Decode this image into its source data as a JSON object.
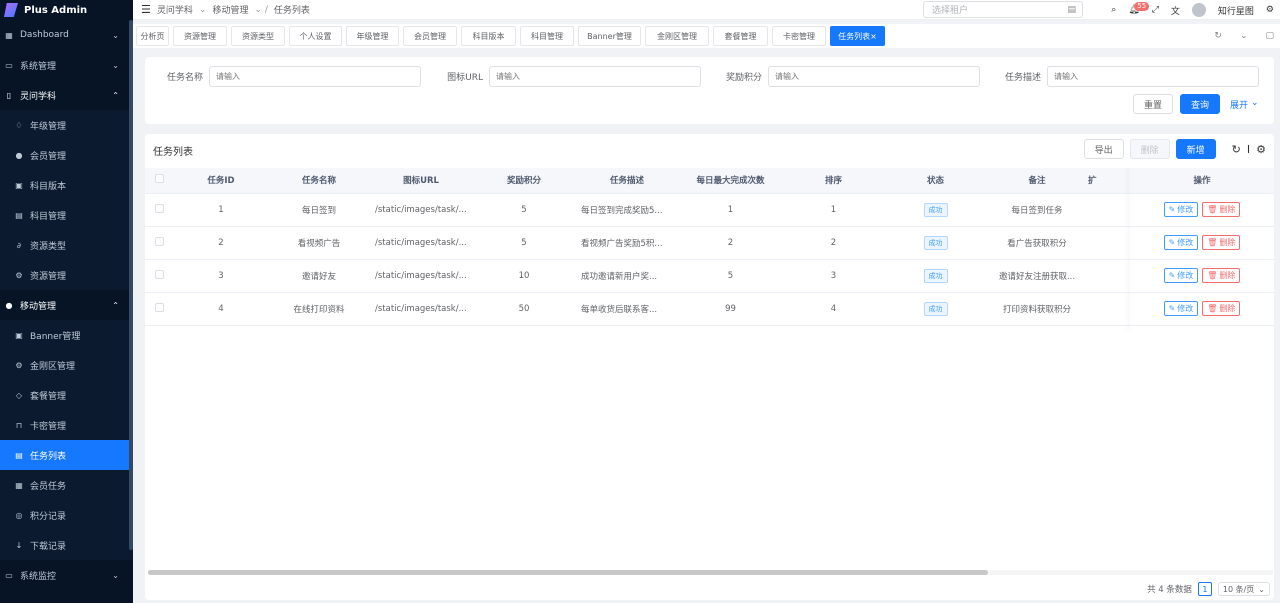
{
  "app": {
    "title": "Plus Admin"
  },
  "sidebar": {
    "items": [
      {
        "label": "Dashboard",
        "icon": "grid-icon",
        "chev": "⌄"
      },
      {
        "label": "系统管理",
        "icon": "monitor-icon",
        "chev": "⌄"
      },
      {
        "label": "灵问学科",
        "icon": "book-icon",
        "chev": "⌃"
      },
      {
        "label": "年级管理",
        "icon": "bell-icon",
        "sub": true
      },
      {
        "label": "会员管理",
        "icon": "chat-icon",
        "sub": true
      },
      {
        "label": "科目版本",
        "icon": "image-icon",
        "sub": true
      },
      {
        "label": "科目管理",
        "icon": "reader-icon",
        "sub": true
      },
      {
        "label": "资源类型",
        "icon": "link-icon",
        "sub": true
      },
      {
        "label": "资源管理",
        "icon": "settings-icon",
        "sub": true
      },
      {
        "label": "移动管理",
        "icon": "chat-icon",
        "chev": "⌃"
      },
      {
        "label": "Banner管理",
        "icon": "image-icon",
        "sub": true
      },
      {
        "label": "金刚区管理",
        "icon": "settings-icon",
        "sub": true
      },
      {
        "label": "套餐管理",
        "icon": "package-icon",
        "sub": true
      },
      {
        "label": "卡密管理",
        "icon": "lock-icon",
        "sub": true
      },
      {
        "label": "任务列表",
        "icon": "list-icon",
        "sub": true,
        "active": true
      },
      {
        "label": "会员任务",
        "icon": "grid-icon",
        "sub": true
      },
      {
        "label": "积分记录",
        "icon": "circle-icon",
        "sub": true
      },
      {
        "label": "下载记录",
        "icon": "download-icon",
        "sub": true
      },
      {
        "label": "系统监控",
        "icon": "monitor-icon",
        "chev": "⌄"
      }
    ]
  },
  "header": {
    "breadcrumb": [
      "灵问学科",
      "移动管理",
      "任务列表"
    ],
    "tenant_placeholder": "选择租户",
    "notification_count": "55",
    "username": "知行星图"
  },
  "tabs": [
    "分析页",
    "资源管理",
    "资源类型",
    "个人设置",
    "年级管理",
    "会员管理",
    "科目版本",
    "科目管理",
    "Banner管理",
    "金刚区管理",
    "套餐管理",
    "卡密管理",
    "任务列表"
  ],
  "search": {
    "fields": [
      {
        "label": "任务名称",
        "placeholder": "请输入"
      },
      {
        "label": "图标URL",
        "placeholder": "请输入"
      },
      {
        "label": "奖励积分",
        "placeholder": "请输入"
      },
      {
        "label": "任务描述",
        "placeholder": "请输入"
      }
    ],
    "reset": "重置",
    "query": "查询",
    "expand": "展开"
  },
  "table": {
    "title": "任务列表",
    "export": "导出",
    "delete": "删除",
    "add": "新增",
    "columns": [
      "任务ID",
      "任务名称",
      "图标URL",
      "奖励积分",
      "任务描述",
      "每日最大完成次数",
      "排序",
      "状态",
      "备注",
      "扩",
      "操作"
    ],
    "rows": [
      {
        "id": "1",
        "name": "每日签到",
        "url": "/static/images/task/...",
        "points": "5",
        "desc": "每日签到完成奖励5...",
        "max": "1",
        "sort": "1",
        "status": "成功",
        "remark": "每日签到任务"
      },
      {
        "id": "2",
        "name": "看视频广告",
        "url": "/static/images/task/...",
        "points": "5",
        "desc": "看视频广告奖励5积...",
        "max": "2",
        "sort": "2",
        "status": "成功",
        "remark": "看广告获取积分"
      },
      {
        "id": "3",
        "name": "邀请好友",
        "url": "/static/images/task/...",
        "points": "10",
        "desc": "成功邀请新用户奖...",
        "max": "5",
        "sort": "3",
        "status": "成功",
        "remark": "邀请好友注册获取..."
      },
      {
        "id": "4",
        "name": "在线打印资料",
        "url": "/static/images/task/...",
        "points": "50",
        "desc": "每单收货后联系客...",
        "max": "99",
        "sort": "4",
        "status": "成功",
        "remark": "打印资料获取积分"
      }
    ],
    "edit_label": "修改",
    "del_label": "删除"
  },
  "pager": {
    "total": "共 4 条数据",
    "page": "1",
    "size": "10 条/页"
  }
}
